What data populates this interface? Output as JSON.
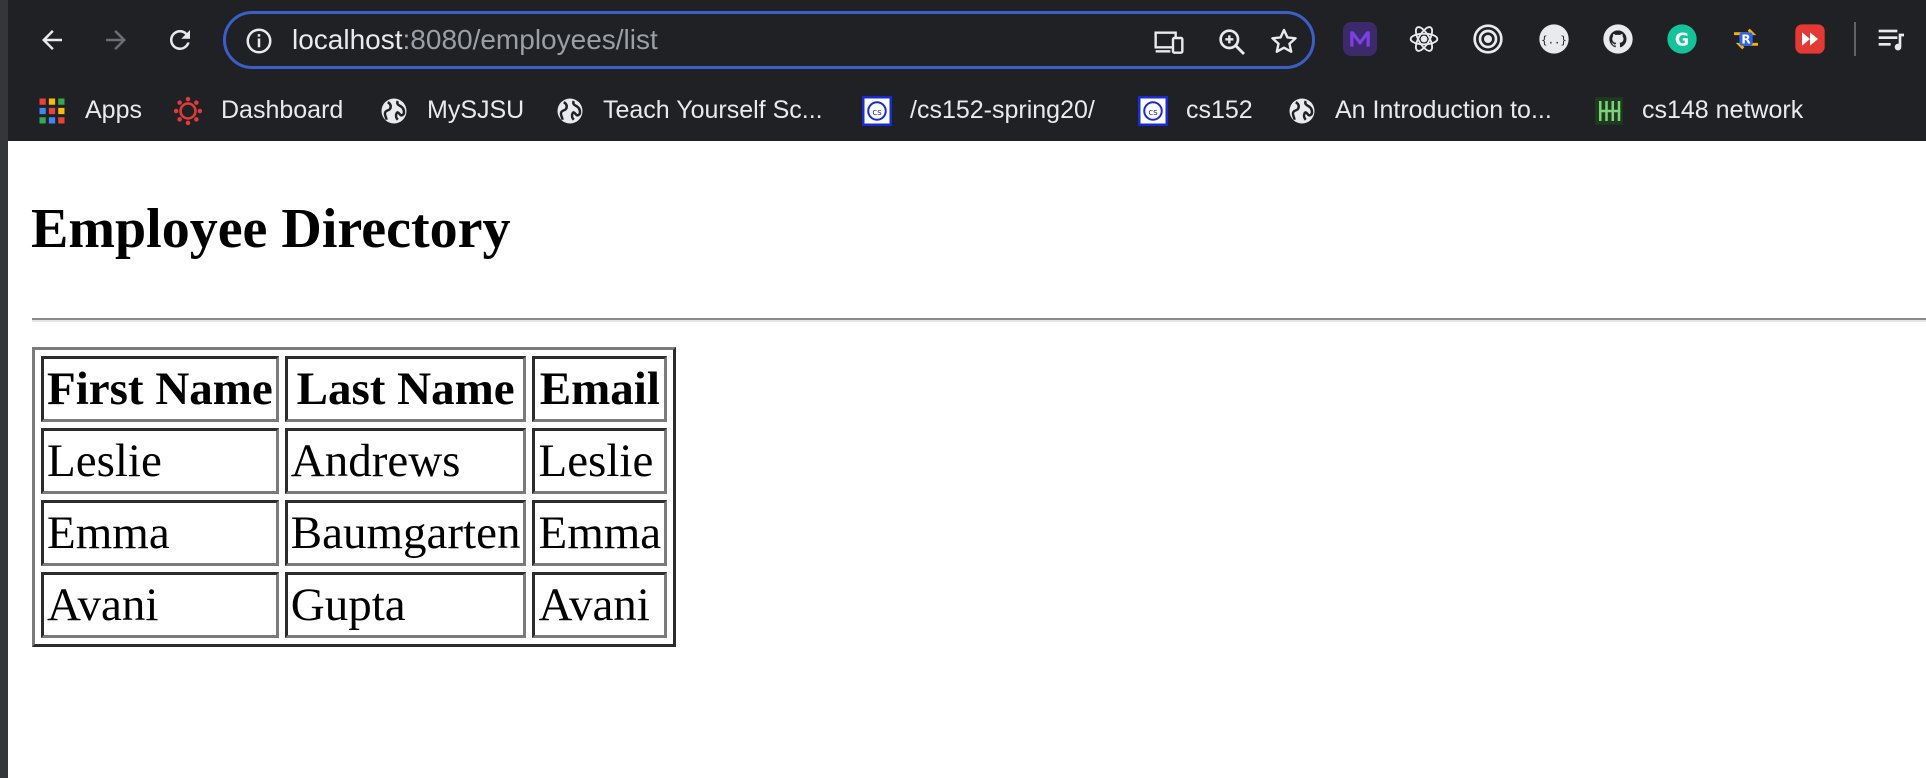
{
  "browser": {
    "url_host": "localhost",
    "url_path": ":8080/employees/list",
    "extensions": [
      {
        "name": "M",
        "color": "#7b3fe4"
      },
      {
        "name": "react",
        "color": "#e8eaed"
      },
      {
        "name": "target",
        "color": "#e8eaed"
      },
      {
        "name": "json",
        "color": "#e8eaed"
      },
      {
        "name": "github",
        "color": "#e8eaed"
      },
      {
        "name": "G",
        "color": "#15c39a"
      },
      {
        "name": "R",
        "color": "#f4b400"
      },
      {
        "name": "rec",
        "color": "#e53935"
      }
    ]
  },
  "bookmarks": [
    {
      "label": "Apps",
      "icon": "apps-grid-icon"
    },
    {
      "label": "Dashboard",
      "icon": "canvas-icon"
    },
    {
      "label": "MySJSU",
      "icon": "globe-icon"
    },
    {
      "label": "Teach Yourself Sc...",
      "icon": "globe-icon"
    },
    {
      "label": "/cs152-spring20/",
      "icon": "cs-icon"
    },
    {
      "label": "cs152",
      "icon": "cs-icon"
    },
    {
      "label": "An Introduction to...",
      "icon": "globe-icon"
    },
    {
      "label": "cs148 network",
      "icon": "network-icon"
    }
  ],
  "page": {
    "title": "Employee Directory",
    "table": {
      "headers": [
        "First Name",
        "Last Name",
        "Email"
      ],
      "rows": [
        [
          "Leslie",
          "Andrews",
          "Leslie"
        ],
        [
          "Emma",
          "Baumgarten",
          "Emma"
        ],
        [
          "Avani",
          "Gupta",
          "Avani"
        ]
      ]
    }
  },
  "colors": {
    "chrome_bg": "#202124",
    "omnibox_border": "#3b5fc6",
    "page_bg": "#ffffff"
  }
}
